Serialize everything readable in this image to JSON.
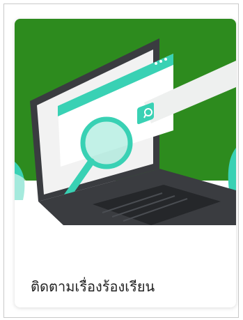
{
  "card": {
    "label": "ติดตามเรื่องร้องเรียน",
    "illustration_icon": "laptop-magnifier-search-illustration"
  },
  "colors": {
    "banner_green": "#2d8b1e",
    "accent_teal": "#39d1b4",
    "laptop_dark": "#3a3c40",
    "screen_light": "#f2f2f2",
    "label_text": "#222222"
  }
}
